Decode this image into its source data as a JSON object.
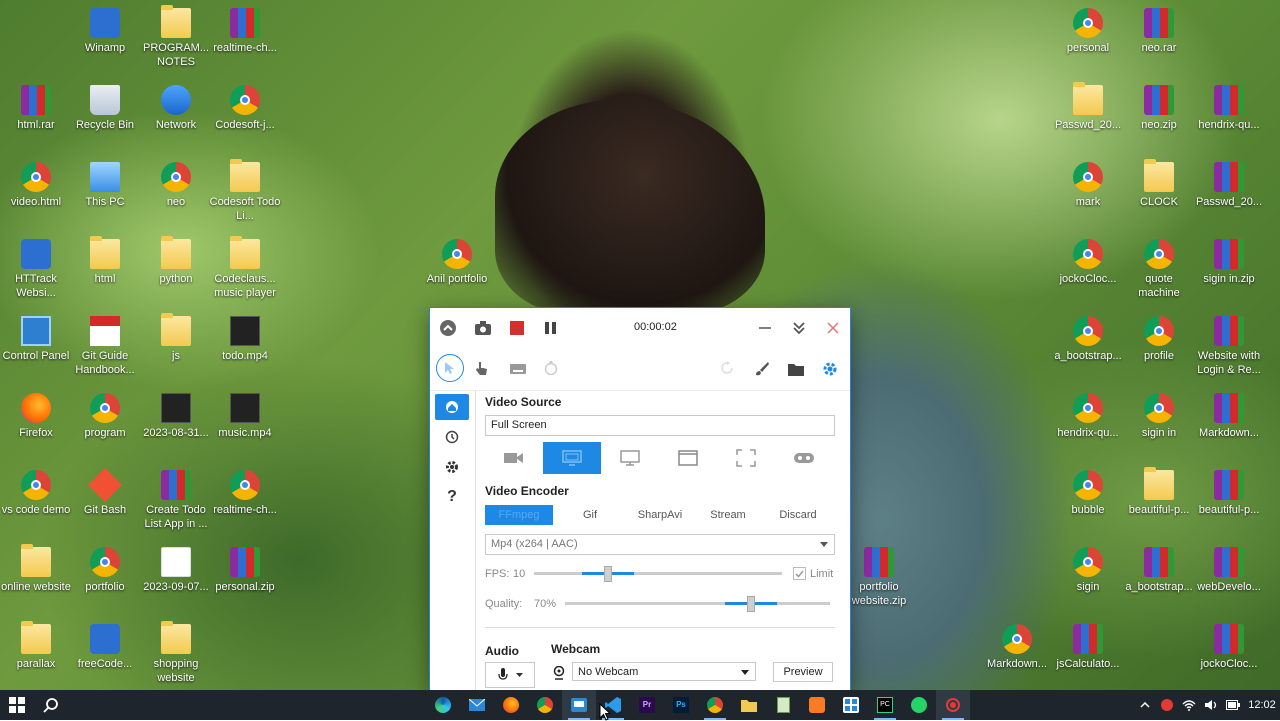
{
  "desktop": {
    "icons": [
      {
        "label": "Winamp",
        "kind": "app"
      },
      {
        "label": "PROGRAM... NOTES",
        "kind": "folder"
      },
      {
        "label": "realtime-ch...",
        "kind": "rar"
      },
      {
        "label": "html.rar",
        "kind": "rar"
      },
      {
        "label": "Recycle Bin",
        "kind": "recycle"
      },
      {
        "label": "Network",
        "kind": "network"
      },
      {
        "label": "Codesoft-j...",
        "kind": "chrome"
      },
      {
        "label": "video.html",
        "kind": "chrome"
      },
      {
        "label": "This PC",
        "kind": "pc"
      },
      {
        "label": "neo",
        "kind": "chrome"
      },
      {
        "label": "Codesoft Todo Li...",
        "kind": "folder"
      },
      {
        "label": "HTTrack Websi...",
        "kind": "app"
      },
      {
        "label": "html",
        "kind": "folder"
      },
      {
        "label": "python",
        "kind": "folder"
      },
      {
        "label": "Codeclaus... music player",
        "kind": "folder"
      },
      {
        "label": "Anil portfolio",
        "kind": "chrome"
      },
      {
        "label": "Control Panel",
        "kind": "cpanel"
      },
      {
        "label": "Git Guide Handbook...",
        "kind": "pdf"
      },
      {
        "label": "js",
        "kind": "folder"
      },
      {
        "label": "todo.mp4",
        "kind": "video"
      },
      {
        "label": "Firefox",
        "kind": "firefox"
      },
      {
        "label": "program",
        "kind": "chrome"
      },
      {
        "label": "2023-08-31...",
        "kind": "video"
      },
      {
        "label": "music.mp4",
        "kind": "video"
      },
      {
        "label": "vs code demo",
        "kind": "chrome"
      },
      {
        "label": "Git Bash",
        "kind": "git"
      },
      {
        "label": "Create Todo List App in ...",
        "kind": "rar"
      },
      {
        "label": "realtime-ch...",
        "kind": "chrome"
      },
      {
        "label": "online website",
        "kind": "folder"
      },
      {
        "label": "portfolio",
        "kind": "chrome"
      },
      {
        "label": "2023-09-07...",
        "kind": "doc"
      },
      {
        "label": "personal.zip",
        "kind": "rar"
      },
      {
        "label": "parallax",
        "kind": "folder"
      },
      {
        "label": "freeCode...",
        "kind": "app"
      },
      {
        "label": "shopping website",
        "kind": "folder"
      },
      {
        "label": "portfolio website.zip",
        "kind": "rar"
      },
      {
        "label": "personal",
        "kind": "chrome"
      },
      {
        "label": "neo.rar",
        "kind": "rar"
      },
      {
        "label": "Passwd_20...",
        "kind": "folder"
      },
      {
        "label": "neo.zip",
        "kind": "rar"
      },
      {
        "label": "hendrix-qu...",
        "kind": "rar"
      },
      {
        "label": "mark",
        "kind": "chrome"
      },
      {
        "label": "CLOCK",
        "kind": "folder"
      },
      {
        "label": "Passwd_20...",
        "kind": "rar"
      },
      {
        "label": "jockoCloc...",
        "kind": "chrome"
      },
      {
        "label": "quote machine",
        "kind": "chrome"
      },
      {
        "label": "sigin in.zip",
        "kind": "rar"
      },
      {
        "label": "a_bootstrap...",
        "kind": "chrome"
      },
      {
        "label": "profile",
        "kind": "chrome"
      },
      {
        "label": "Website with Login & Re...",
        "kind": "rar"
      },
      {
        "label": "hendrix-qu...",
        "kind": "chrome"
      },
      {
        "label": "sigin in",
        "kind": "chrome"
      },
      {
        "label": "Markdown...",
        "kind": "rar"
      },
      {
        "label": "bubble",
        "kind": "chrome"
      },
      {
        "label": "beautiful-p...",
        "kind": "folder"
      },
      {
        "label": "beautiful-p...",
        "kind": "rar"
      },
      {
        "label": "sigin",
        "kind": "chrome"
      },
      {
        "label": "a_bootstrap...",
        "kind": "rar"
      },
      {
        "label": "webDevelo...",
        "kind": "rar"
      },
      {
        "label": "Markdown...",
        "kind": "chrome"
      },
      {
        "label": "jsCalculato...",
        "kind": "rar"
      },
      {
        "label": "jockoCloc...",
        "kind": "rar"
      }
    ]
  },
  "recorder": {
    "timer": "00:00:02",
    "video_source_title": "Video Source",
    "video_source_value": "Full Screen",
    "video_encoder_title": "Video Encoder",
    "encoder_tabs": [
      "FFmpeg",
      "Gif",
      "SharpAvi",
      "Stream",
      "Discard"
    ],
    "active_tab_index": 0,
    "codec": "Mp4 (x264 | AAC)",
    "fps_label": "FPS:",
    "fps_value": "10",
    "limit_label": "Limit",
    "limit_checked": true,
    "quality_label": "Quality:",
    "quality_value": "70%",
    "fps_fraction": 0.3,
    "quality_fraction": 0.7,
    "audio_title": "Audio",
    "webcam_title": "Webcam",
    "webcam_value": "No Webcam",
    "preview_label": "Preview",
    "accent": "#1e88e5",
    "record_color": "#d32f2f"
  },
  "taskbar": {
    "clock": "12:02",
    "apps": [
      "edge",
      "mail",
      "firefox",
      "chrome",
      "recorder",
      "vscode",
      "premiere",
      "photoshop",
      "chrome2",
      "explorer",
      "notepad",
      "xampp",
      "calculator",
      "pycharm",
      "whatsapp",
      "record"
    ]
  }
}
